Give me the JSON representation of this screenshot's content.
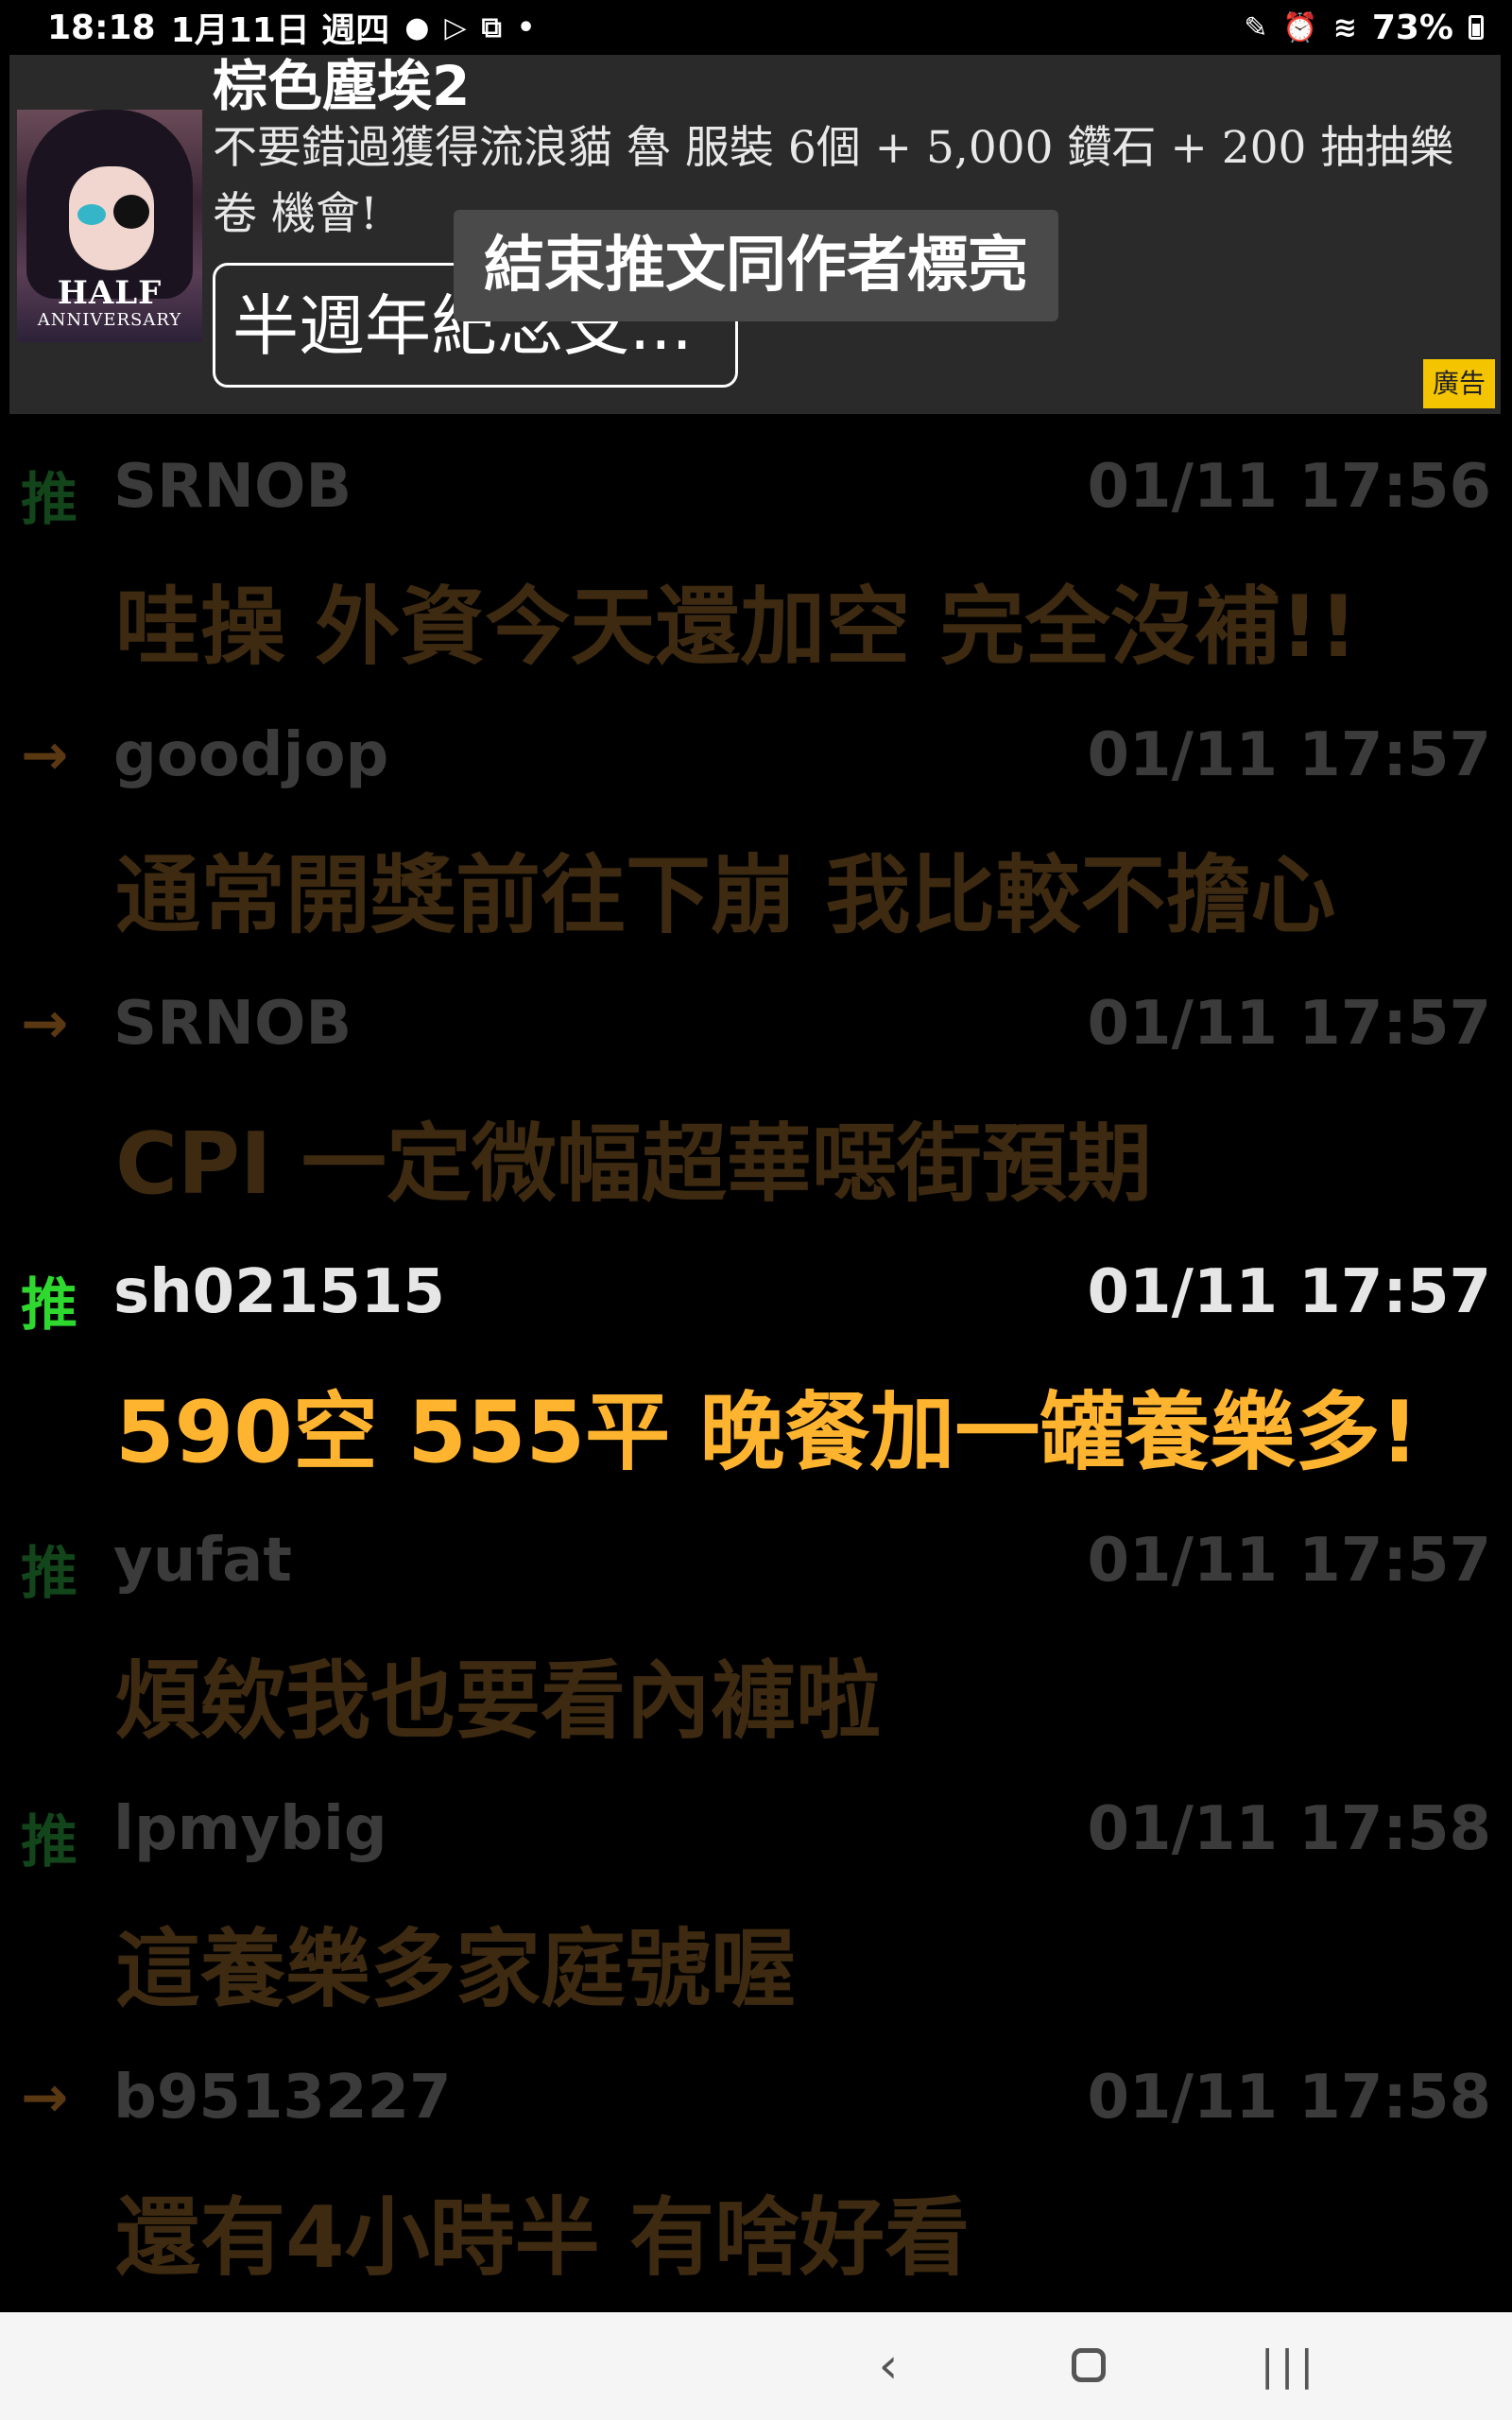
{
  "status_bar": {
    "time": "18:18",
    "date": "1月11日 週四",
    "battery": "73%",
    "icons_left": [
      "line-icon",
      "play-icon",
      "dropbox-icon",
      "dot-icon"
    ],
    "icons_right": [
      "pen-icon",
      "alarm-icon",
      "wifi-icon",
      "battery-icon"
    ]
  },
  "ad": {
    "title_cut": "棕色塵埃2",
    "body": "不要錯過獲得流浪貓 魯 服裝 6個 + 5,000 鑽石 + 200 抽抽樂卷 機會!",
    "avatar_badge_line1": "HALF",
    "avatar_badge_line2": "ANNIVERSARY",
    "button_label": "半週年紀念支...",
    "label": "廣告"
  },
  "toast": "結束推文同作者標亮",
  "comments": [
    {
      "tag": "推",
      "type": "push",
      "user": "SRNOB",
      "time": "01/11 17:56",
      "text": "哇操  外資今天還加空  完全沒補!!",
      "highlighted": false
    },
    {
      "tag": "→",
      "type": "arrow",
      "user": "goodjop",
      "time": "01/11 17:57",
      "text": "通常開獎前往下崩  我比較不擔心",
      "highlighted": false
    },
    {
      "tag": "→",
      "type": "arrow",
      "user": "SRNOB",
      "time": "01/11 17:57",
      "text": "CPI  一定微幅超華噁街預期",
      "highlighted": false
    },
    {
      "tag": "推",
      "type": "push",
      "user": "sh021515",
      "time": "01/11 17:57",
      "text": "590空  555平  晚餐加一罐養樂多!",
      "highlighted": true
    },
    {
      "tag": "推",
      "type": "push",
      "user": "yufat",
      "time": "01/11 17:57",
      "text": "煩欸我也要看內褲啦",
      "highlighted": false
    },
    {
      "tag": "推",
      "type": "push",
      "user": "lpmybig",
      "time": "01/11 17:58",
      "text": "這養樂多家庭號喔",
      "highlighted": false
    },
    {
      "tag": "→",
      "type": "arrow",
      "user": "b9513227",
      "time": "01/11 17:58",
      "text": "還有4小時半  有啥好看",
      "highlighted": false
    }
  ],
  "nav": {
    "back_icon": "back-icon",
    "home_icon": "home-icon",
    "recents_icon": "recents-icon"
  },
  "colors": {
    "push_highlight": "#2fd82f",
    "text_highlight": "#ffb430",
    "ad_label": "#f5c400"
  }
}
